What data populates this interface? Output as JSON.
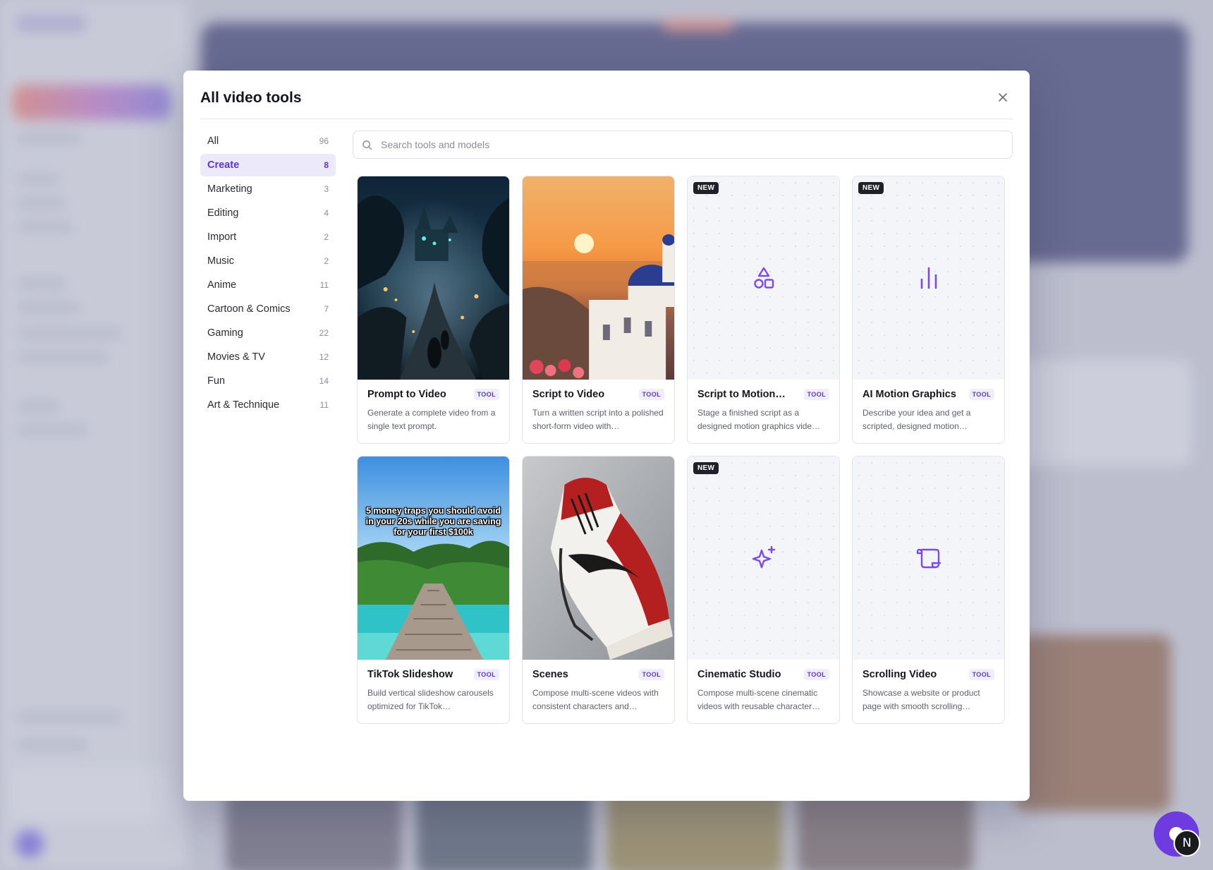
{
  "modal": {
    "title": "All video tools",
    "search_placeholder": "Search tools and models"
  },
  "categories": [
    {
      "label": "All",
      "count": "96",
      "active": false
    },
    {
      "label": "Create",
      "count": "8",
      "active": true
    },
    {
      "label": "Marketing",
      "count": "3",
      "active": false
    },
    {
      "label": "Editing",
      "count": "4",
      "active": false
    },
    {
      "label": "Import",
      "count": "2",
      "active": false
    },
    {
      "label": "Music",
      "count": "2",
      "active": false
    },
    {
      "label": "Anime",
      "count": "11",
      "active": false
    },
    {
      "label": "Cartoon & Comics",
      "count": "7",
      "active": false
    },
    {
      "label": "Gaming",
      "count": "22",
      "active": false
    },
    {
      "label": "Movies & TV",
      "count": "12",
      "active": false
    },
    {
      "label": "Fun",
      "count": "14",
      "active": false
    },
    {
      "label": "Art & Technique",
      "count": "11",
      "active": false
    }
  ],
  "tools": [
    {
      "title": "Prompt to Video",
      "tag": "TOOL",
      "desc": "Generate a complete video from a single text prompt.",
      "thumb": "fantasy-village-image",
      "new": false
    },
    {
      "title": "Script to Video",
      "tag": "TOOL",
      "desc": "Turn a written script into a polished short-form video with…",
      "thumb": "santorini-sunset-image",
      "new": false
    },
    {
      "title": "Script to Motion…",
      "tag": "TOOL",
      "desc": "Stage a finished script as a designed motion graphics vide…",
      "thumb": "shapes-icon",
      "new": true,
      "badge": "NEW"
    },
    {
      "title": "AI Motion Graphics",
      "tag": "TOOL",
      "desc": "Describe your idea and get a scripted, designed motion…",
      "thumb": "bar-chart-icon",
      "new": true,
      "badge": "NEW"
    },
    {
      "title": "TikTok Slideshow",
      "tag": "TOOL",
      "desc": "Build vertical slideshow carousels optimized for TikTok…",
      "thumb": "beach-pier-image",
      "new": false,
      "caption": "5 money traps you should avoid in your 20s while you are saving for your first $100k"
    },
    {
      "title": "Scenes",
      "tag": "TOOL",
      "desc": "Compose multi-scene videos with consistent characters and…",
      "thumb": "sneaker-image",
      "new": false
    },
    {
      "title": "Cinematic Studio",
      "tag": "TOOL",
      "desc": "Compose multi-scene cinematic videos with reusable character…",
      "thumb": "sparkles-icon",
      "new": true,
      "badge": "NEW"
    },
    {
      "title": "Scrolling Video",
      "tag": "TOOL",
      "desc": "Showcase a website or product page with smooth scrolling…",
      "thumb": "scroll-icon",
      "new": false
    }
  ],
  "chat_badge": "N",
  "colors": {
    "accent": "#5b34d6",
    "accent_bg": "#ece9fb",
    "chat_fab": "#6d3be0"
  }
}
